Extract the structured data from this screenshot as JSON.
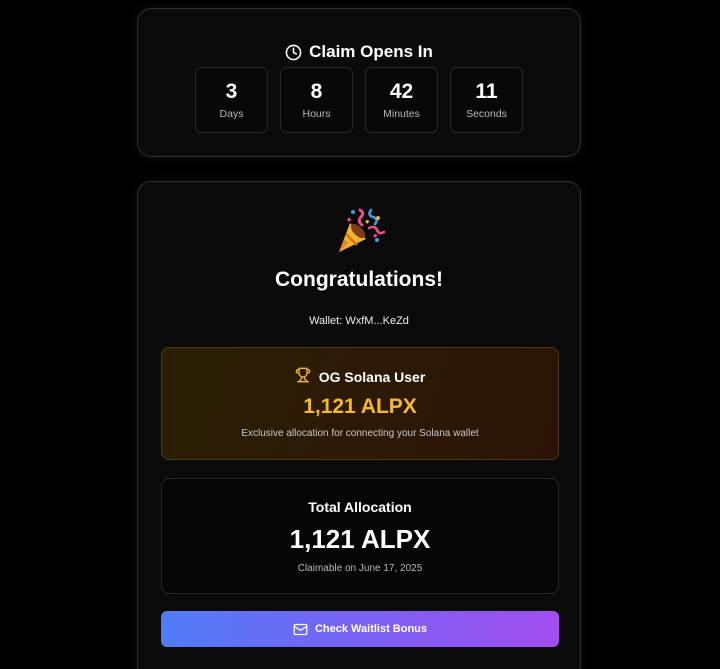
{
  "countdown": {
    "title": "Claim Opens In",
    "icon": "clock-icon",
    "units": [
      {
        "value": "3",
        "label": "Days"
      },
      {
        "value": "8",
        "label": "Hours"
      },
      {
        "value": "42",
        "label": "Minutes"
      },
      {
        "value": "11",
        "label": "Seconds"
      }
    ]
  },
  "result": {
    "icon": "party-popper-icon",
    "title": "Congratulations!",
    "wallet": "Wallet: WxfM...KeZd"
  },
  "og_reward": {
    "icon": "trophy-icon",
    "title": "OG Solana User",
    "amount": "1,121 ALPX",
    "description": "Exclusive allocation for connecting your Solana wallet",
    "accent_color": "#f5b92a"
  },
  "total": {
    "title": "Total Allocation",
    "amount": "1,121 ALPX",
    "claimable": "Claimable on June 17, 2025"
  },
  "waitlist_button": {
    "icon": "mail-icon",
    "label": "Check Waitlist Bonus",
    "gradient": [
      "#4f7cf7",
      "#a24ef1"
    ]
  }
}
